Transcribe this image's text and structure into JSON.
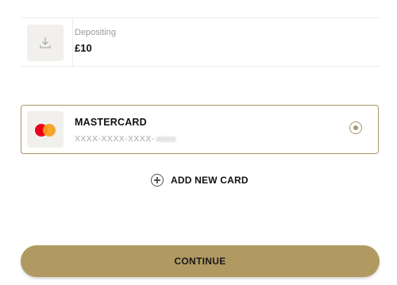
{
  "deposit": {
    "label": "Depositing",
    "amount": "£10",
    "icon": "download-icon"
  },
  "payment_methods": [
    {
      "brand": "MASTERCARD",
      "number_masked": "XXXX-XXXX-XXXX-",
      "selected": true,
      "icon": "mastercard-logo"
    }
  ],
  "add_card": {
    "label": "ADD NEW CARD",
    "icon": "plus-circle-icon"
  },
  "continue_button": {
    "label": "CONTINUE"
  },
  "colors": {
    "accent": "#b09a62",
    "border_selected": "#a8976a"
  }
}
